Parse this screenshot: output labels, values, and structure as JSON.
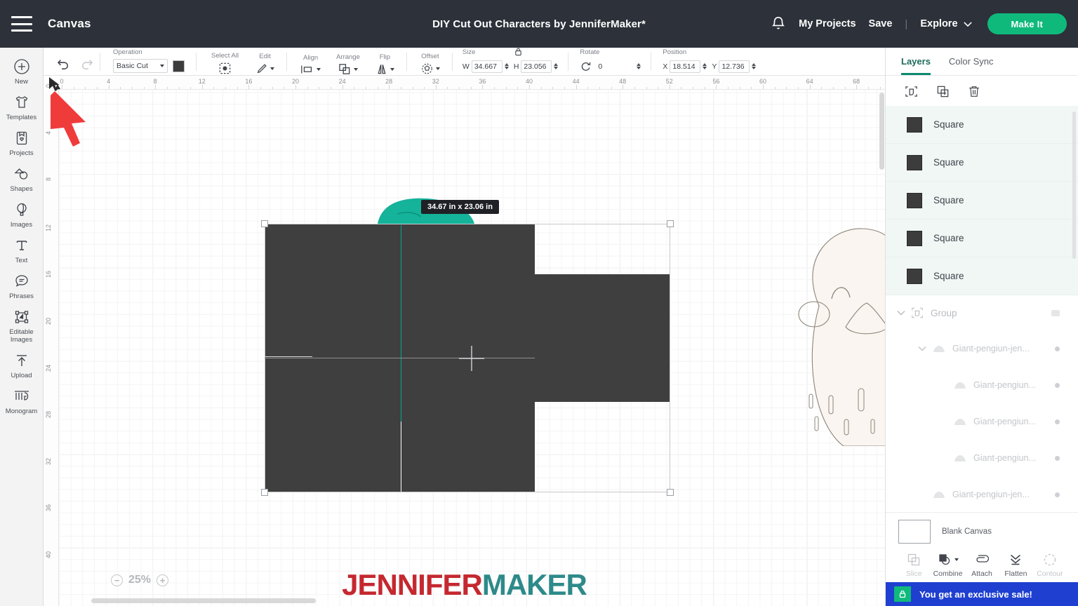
{
  "header": {
    "menu_icon": "hamburger-icon",
    "canvas_label": "Canvas",
    "document_title": "DIY Cut Out Characters by JenniferMaker*",
    "bell_icon": "notification-bell-icon",
    "my_projects": "My Projects",
    "save": "Save",
    "separator": "|",
    "explore": "Explore",
    "explore_chevron": "chevron-down-icon",
    "make_it": "Make It",
    "bg_color": "#2d3139",
    "accent_green": "#0fb97c"
  },
  "toolbar": {
    "undo_icon": "undo-icon",
    "redo_icon": "redo-icon",
    "operation": {
      "caption": "Operation",
      "value": "Basic Cut",
      "swatch_color": "#3c3c3c"
    },
    "select_all": {
      "caption": "Select All",
      "icon": "select-all-icon"
    },
    "edit": {
      "caption": "Edit",
      "icon": "pencil-edit-icon"
    },
    "align": {
      "caption": "Align",
      "icon": "align-icon"
    },
    "arrange": {
      "caption": "Arrange",
      "icon": "arrange-icon"
    },
    "flip": {
      "caption": "Flip",
      "icon": "flip-icon"
    },
    "offset": {
      "caption": "Offset",
      "icon": "offset-icon"
    },
    "size": {
      "caption": "Size",
      "lock_icon": "lock-icon",
      "w_label": "W",
      "w_value": "34.667",
      "h_label": "H",
      "h_value": "23.056"
    },
    "rotate": {
      "caption": "Rotate",
      "icon": "rotate-icon",
      "value": "0"
    },
    "position": {
      "caption": "Position",
      "x_label": "X",
      "x_value": "18.514",
      "y_label": "Y",
      "y_value": "12.736"
    }
  },
  "sidebar": {
    "items": [
      {
        "label": "New",
        "icon": "plus-circle-icon"
      },
      {
        "label": "Templates",
        "icon": "tshirt-icon"
      },
      {
        "label": "Projects",
        "icon": "project-card-icon"
      },
      {
        "label": "Shapes",
        "icon": "shapes-icon"
      },
      {
        "label": "Images",
        "icon": "hot-air-balloon-icon"
      },
      {
        "label": "Text",
        "icon": "text-t-icon"
      },
      {
        "label": "Phrases",
        "icon": "speech-bubble-icon"
      },
      {
        "label": "Editable Images",
        "icon": "editable-images-icon"
      },
      {
        "label": "Upload",
        "icon": "upload-arrow-icon"
      },
      {
        "label": "Monogram",
        "icon": "monogram-icon"
      }
    ]
  },
  "canvas": {
    "ruler_h_ticks": [
      "0",
      "4",
      "8",
      "12",
      "16",
      "20",
      "24",
      "28",
      "32",
      "36",
      "40",
      "44",
      "48",
      "52",
      "56",
      "60",
      "64",
      "68"
    ],
    "ruler_v_ticks": [
      "0",
      "4",
      "8",
      "12",
      "16",
      "20",
      "24",
      "28",
      "32",
      "36",
      "40"
    ],
    "size_tooltip": "34.67  in x 23.06  in",
    "zoom_level": "25%",
    "zoom_out_icon": "minus-circle-icon",
    "zoom_in_icon": "plus-circle-icon",
    "watermark_part1": "JENNIFER",
    "watermark_part2": "MAKER",
    "watermark_color1": "#c5282f",
    "watermark_color2": "#2e8a8a",
    "shape_fill": "#3f3f3f",
    "teal_fill": "#14b39a",
    "guide_color": "#00a887",
    "cursor_color": "#f03b3b",
    "penguin_fill": "#faf5f0",
    "penguin_stroke": "#8d8578"
  },
  "right_panel": {
    "tabs": [
      {
        "label": "Layers",
        "active": true
      },
      {
        "label": "Color Sync",
        "active": false
      }
    ],
    "tools": [
      {
        "icon": "group-select-icon"
      },
      {
        "icon": "duplicate-icon"
      },
      {
        "icon": "trash-icon"
      }
    ],
    "layers": [
      {
        "name": "Square",
        "color": "#3c3c3c"
      },
      {
        "name": "Square",
        "color": "#3c3c3c"
      },
      {
        "name": "Square",
        "color": "#3c3c3c"
      },
      {
        "name": "Square",
        "color": "#3c3c3c"
      },
      {
        "name": "Square",
        "color": "#3c3c3c"
      }
    ],
    "group": {
      "label": "Group",
      "chevron": "chevron-down-icon",
      "icon": "group-icon",
      "children": [
        {
          "name": "Giant-pengiun-jen...",
          "indent": 1,
          "chevron": true
        },
        {
          "name": "Giant-pengiun...",
          "indent": 2,
          "chevron": false
        },
        {
          "name": "Giant-pengiun...",
          "indent": 2,
          "chevron": false
        },
        {
          "name": "Giant-pengiun...",
          "indent": 2,
          "chevron": false
        },
        {
          "name": "Giant-pengiun-jen...",
          "indent": 1,
          "chevron": false
        }
      ]
    },
    "blank_canvas": {
      "label": "Blank Canvas"
    },
    "bottom_tools": [
      {
        "label": "Slice",
        "icon": "slice-icon",
        "disabled": true
      },
      {
        "label": "Combine",
        "icon": "combine-icon",
        "disabled": false
      },
      {
        "label": "Attach",
        "icon": "attach-icon",
        "disabled": false
      },
      {
        "label": "Flatten",
        "icon": "flatten-icon",
        "disabled": false
      },
      {
        "label": "Contour",
        "icon": "contour-icon",
        "disabled": true
      }
    ],
    "promo": {
      "text": "You get an exclusive sale!",
      "icon": "tag-lock-icon",
      "bg_color": "#1e3fd0"
    }
  }
}
